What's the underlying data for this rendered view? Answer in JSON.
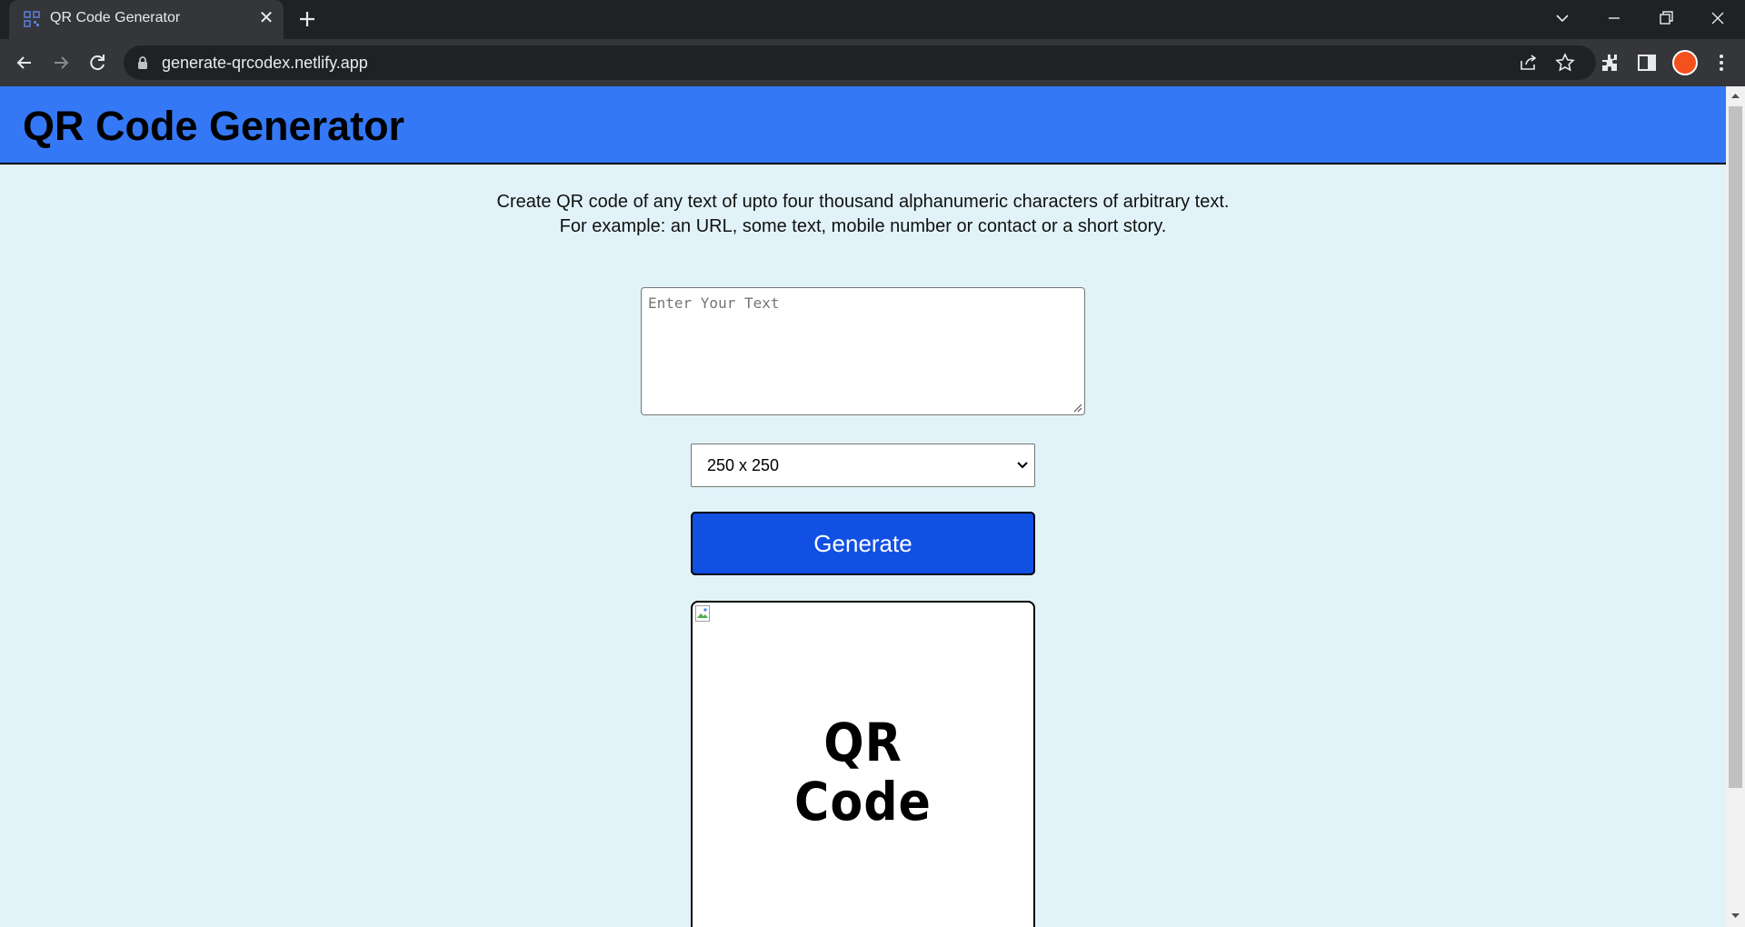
{
  "browser": {
    "tab_title": "QR Code Generator",
    "url": "generate-qrcodex.netlify.app"
  },
  "header": {
    "title": "QR Code Generator"
  },
  "description": {
    "line1": "Create QR code of any text of upto four thousand alphanumeric characters of arbitrary text.",
    "line2": "For example: an URL, some text, mobile number or contact or a short story."
  },
  "form": {
    "text_placeholder": "Enter Your Text",
    "text_value": "",
    "size_selected": "250 x 250",
    "generate_label": "Generate"
  },
  "qr_preview": {
    "line1": "QR",
    "line2": "Code"
  },
  "colors": {
    "header_bg": "#3578f6",
    "page_bg": "#e1f3f9",
    "button_bg": "#1150e3"
  }
}
